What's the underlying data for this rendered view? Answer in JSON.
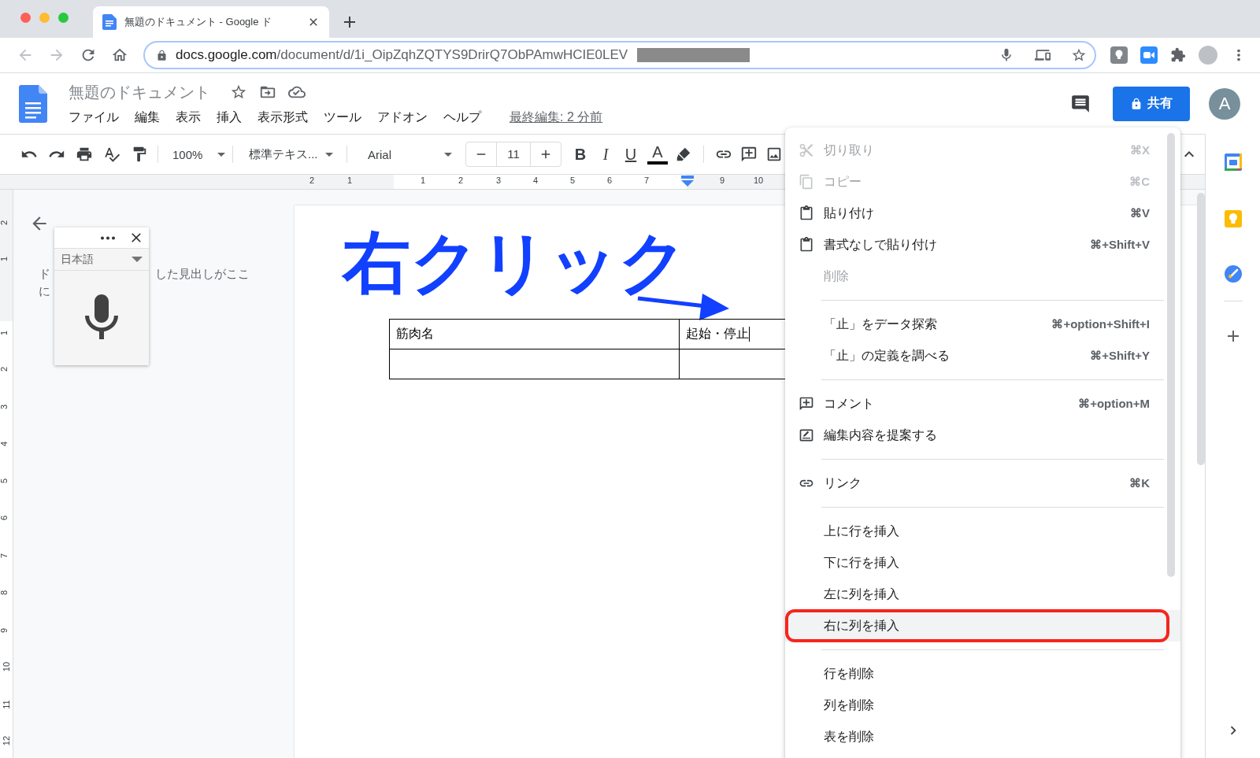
{
  "browser": {
    "tab_title": "無題のドキュメント - Google ド",
    "url_host": "docs.google.com",
    "url_path": "/document/d/1i_OipZqhZQTYS9DrirQ7ObPAmwHCIE0LEV"
  },
  "document": {
    "title": "無題のドキュメント",
    "menus": [
      "ファイル",
      "編集",
      "表示",
      "挿入",
      "表示形式",
      "ツール",
      "アドオン",
      "ヘルプ"
    ],
    "last_edit": "最終編集: 2 分前",
    "share": "共有",
    "avatar": "A"
  },
  "toolbar": {
    "zoom": "100%",
    "style": "標準テキス...",
    "font": "Arial",
    "font_size": "11",
    "bold": "B",
    "italic": "I",
    "underline": "U",
    "text_color": "A"
  },
  "ruler": {
    "horizontal": [
      "2",
      "1",
      "1",
      "2",
      "3",
      "4",
      "5",
      "6",
      "7",
      "9",
      "10"
    ],
    "vertical": [
      "2",
      "1",
      "1",
      "2",
      "3",
      "4",
      "5",
      "6",
      "7",
      "8",
      "9",
      "10",
      "11",
      "12"
    ]
  },
  "outline": {
    "line_1_start": "ド",
    "line_1_end": "した見出しがここ",
    "line_2_start": "に"
  },
  "voice_typing": {
    "language": "日本語"
  },
  "annotation": {
    "text": "右クリック"
  },
  "table": {
    "header": [
      "筋肉名",
      "起始・停止"
    ]
  },
  "context_menu": {
    "items": [
      {
        "kind": "item",
        "label": "切り取り",
        "shortcut": "⌘X",
        "disabled": true,
        "selected": false
      },
      {
        "kind": "item",
        "label": "コピー",
        "shortcut": "⌘C",
        "disabled": true,
        "selected": false
      },
      {
        "kind": "item",
        "label": "貼り付け",
        "shortcut": "⌘V",
        "disabled": false,
        "selected": false
      },
      {
        "kind": "item",
        "label": "書式なしで貼り付け",
        "shortcut": "⌘+Shift+V",
        "disabled": false,
        "selected": false
      },
      {
        "kind": "item",
        "label": "削除",
        "disabled": true,
        "selected": false
      },
      {
        "kind": "separator"
      },
      {
        "kind": "item",
        "label": "「止」をデータ探索",
        "shortcut": "⌘+option+Shift+I",
        "disabled": false,
        "selected": false
      },
      {
        "kind": "item",
        "label": "「止」の定義を調べる",
        "shortcut": "⌘+Shift+Y",
        "disabled": false,
        "selected": false
      },
      {
        "kind": "separator"
      },
      {
        "kind": "item",
        "label": "コメント",
        "shortcut": "⌘+option+M",
        "disabled": false,
        "selected": false
      },
      {
        "kind": "item",
        "label": "編集内容を提案する",
        "disabled": false,
        "selected": false
      },
      {
        "kind": "separator"
      },
      {
        "kind": "item",
        "label": "リンク",
        "shortcut": "⌘K",
        "disabled": false,
        "selected": false
      },
      {
        "kind": "separator"
      },
      {
        "kind": "item",
        "label": "上に行を挿入",
        "disabled": false,
        "selected": false
      },
      {
        "kind": "item",
        "label": "下に行を挿入",
        "disabled": false,
        "selected": false
      },
      {
        "kind": "item",
        "label": "左に列を挿入",
        "disabled": false,
        "selected": false
      },
      {
        "kind": "item",
        "label": "右に列を挿入",
        "disabled": false,
        "selected": true
      },
      {
        "kind": "separator"
      },
      {
        "kind": "item",
        "label": "行を削除",
        "disabled": false,
        "selected": false
      },
      {
        "kind": "item",
        "label": "列を削除",
        "disabled": false,
        "selected": false
      },
      {
        "kind": "item",
        "label": "表を削除",
        "disabled": false,
        "selected": false
      }
    ]
  }
}
